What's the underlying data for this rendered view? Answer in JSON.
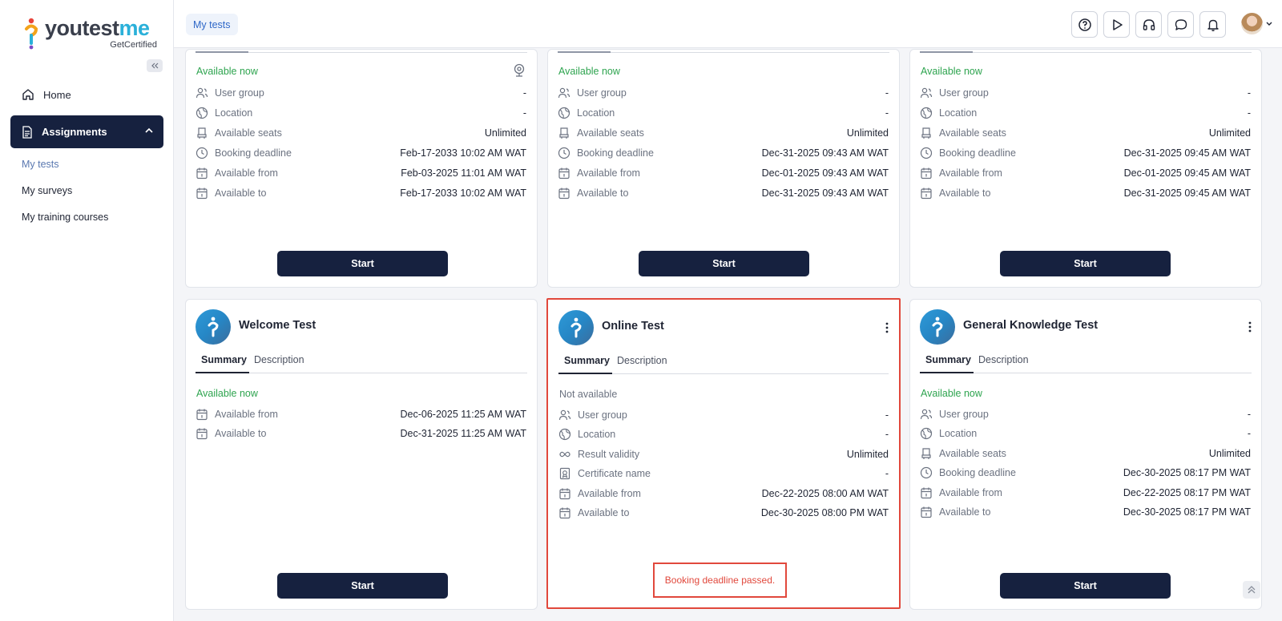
{
  "brand": {
    "name_pre": "youtest",
    "name_accent": "me",
    "tagline": "GetCertified"
  },
  "sidebar": {
    "home": "Home",
    "assignments": "Assignments",
    "sub_items": [
      "My tests",
      "My surveys",
      "My training courses"
    ]
  },
  "header": {
    "breadcrumb": "My tests",
    "buttons": [
      "help-icon",
      "play-icon",
      "headset-icon",
      "chat-icon",
      "bell-icon"
    ]
  },
  "labels": {
    "user_group": "User group",
    "location": "Location",
    "available_seats": "Available seats",
    "booking_deadline": "Booking deadline",
    "available_from": "Available from",
    "available_to": "Available to",
    "result_validity": "Result validity",
    "certificate_name": "Certificate name",
    "summary": "Summary",
    "description": "Description",
    "start": "Start"
  },
  "cards_top": [
    {
      "status": "Available now",
      "user_group": "-",
      "location": "-",
      "seats": "Unlimited",
      "booking_deadline": "Feb-17-2033 10:02 AM WAT",
      "from": "Feb-03-2025 11:01 AM WAT",
      "to": "Feb-17-2033 10:02 AM WAT"
    },
    {
      "status": "Available now",
      "user_group": "-",
      "location": "-",
      "seats": "Unlimited",
      "booking_deadline": "Dec-31-2025 09:43 AM WAT",
      "from": "Dec-01-2025 09:43 AM WAT",
      "to": "Dec-31-2025 09:43 AM WAT"
    },
    {
      "status": "Available now",
      "user_group": "-",
      "location": "-",
      "seats": "Unlimited",
      "booking_deadline": "Dec-31-2025 09:45 AM WAT",
      "from": "Dec-01-2025 09:45 AM WAT",
      "to": "Dec-31-2025 09:45 AM WAT"
    }
  ],
  "cards_bottom": [
    {
      "title": "Welcome Test",
      "status": "Available now",
      "from": "Dec-06-2025 11:25 AM WAT",
      "to": "Dec-31-2025 11:25 AM WAT"
    },
    {
      "title": "Online Test",
      "status": "Not available",
      "user_group": "-",
      "location": "-",
      "result_validity": "Unlimited",
      "certificate_name": "-",
      "from": "Dec-22-2025 08:00 AM WAT",
      "to": "Dec-30-2025 08:00 PM WAT",
      "notice": "Booking deadline passed."
    },
    {
      "title": "General Knowledge Test",
      "status": "Available now",
      "user_group": "-",
      "location": "-",
      "seats": "Unlimited",
      "booking_deadline": "Dec-30-2025 08:17 PM WAT",
      "from": "Dec-22-2025 08:17 PM WAT",
      "to": "Dec-30-2025 08:17 PM WAT"
    }
  ],
  "colors": {
    "navy": "#16213f",
    "green": "#2ea44f",
    "red": "#e1483c",
    "link": "#2f68c8"
  }
}
